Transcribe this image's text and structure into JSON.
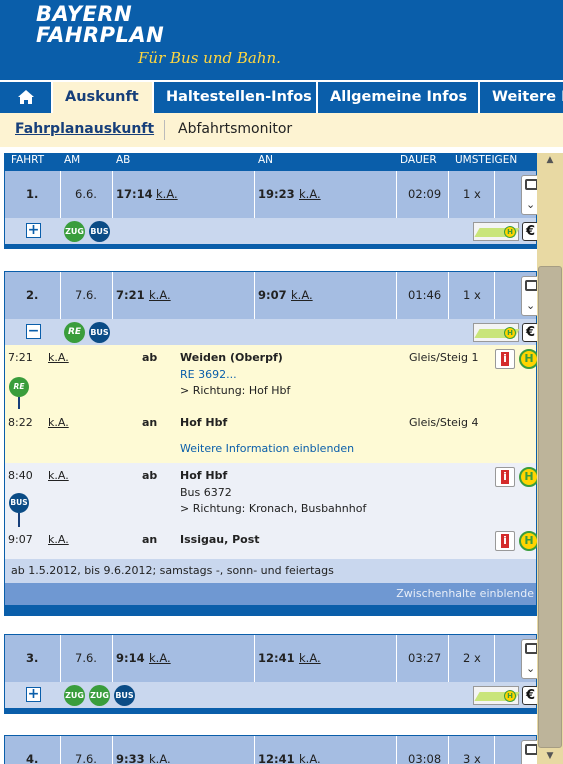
{
  "brand": {
    "line1": "BAYERN",
    "line2": "FAHRPLAN",
    "tagline": "Für Bus und Bahn."
  },
  "nav": {
    "home_icon": "home-icon",
    "tabs": [
      "Auskunft",
      "Haltestellen-Infos",
      "Allgemeine Infos",
      "Weitere D"
    ],
    "active": "Auskunft"
  },
  "subnav": {
    "tabs": [
      "Fahrplanauskunft",
      "Abfahrtsmonitor"
    ],
    "active": "Fahrplanauskunft"
  },
  "columns": {
    "fahrt": "FAHRT",
    "am": "AM",
    "ab": "AB",
    "an": "AN",
    "dauer": "DAUER",
    "umsteigen": "UMSTEIGEN"
  },
  "connections": [
    {
      "num": "1.",
      "date": "6.6.",
      "dep": "17:14",
      "dep_rt": "k.A.",
      "arr": "19:23",
      "arr_rt": "k.A.",
      "duration": "02:09",
      "changes": "1 x",
      "products": [
        "ZUG",
        "BUS"
      ],
      "expand": "+"
    },
    {
      "num": "2.",
      "date": "7.6.",
      "dep": "7:21",
      "dep_rt": "k.A.",
      "arr": "9:07",
      "arr_rt": "k.A.",
      "duration": "01:46",
      "changes": "1 x",
      "products": [
        "RE",
        "BUS"
      ],
      "expand": "−"
    },
    {
      "num": "3.",
      "date": "7.6.",
      "dep": "9:14",
      "dep_rt": "k.A.",
      "arr": "12:41",
      "arr_rt": "k.A.",
      "duration": "03:27",
      "changes": "2 x",
      "products": [
        "ZUG",
        "ZUG",
        "BUS"
      ],
      "expand": "+"
    },
    {
      "num": "4.",
      "date": "7.6.",
      "dep": "9:33",
      "dep_rt": "k.A.",
      "arr": "12:41",
      "arr_rt": "k.A.",
      "duration": "03:08",
      "changes": "3 x"
    }
  ],
  "details": {
    "leg1": {
      "dep_time": "7:21",
      "dep_rt": "k.A.",
      "dep_dir": "ab",
      "dep_stop": "Weiden (Oberpf)",
      "line": "RE 3692...",
      "direction": "> Richtung: Hof Hbf",
      "dep_platform": "Gleis/Steig 1",
      "arr_time": "8:22",
      "arr_rt": "k.A.",
      "arr_dir": "an",
      "arr_stop": "Hof Hbf",
      "arr_platform": "Gleis/Steig 4",
      "more_info": "Weitere Information einblenden",
      "badge": "RE"
    },
    "leg2": {
      "dep_time": "8:40",
      "dep_rt": "k.A.",
      "dep_dir": "ab",
      "dep_stop": "Hof Hbf",
      "line": "Bus 6372",
      "direction": "> Richtung: Kronach, Busbahnhof",
      "arr_time": "9:07",
      "arr_rt": "k.A.",
      "arr_dir": "an",
      "arr_stop": "Issigau, Post",
      "badge": "BUS"
    },
    "note": "ab 1.5.2012, bis 9.6.2012; samstags -, sonn- und feiertags",
    "stops_toggle": "Zwischenhalte einblende"
  },
  "icons": {
    "euro": "€",
    "h": "H",
    "info": "i",
    "up": "▲",
    "down": "▼",
    "print": "printer-icon",
    "chevron": "chevron-down-icon"
  }
}
